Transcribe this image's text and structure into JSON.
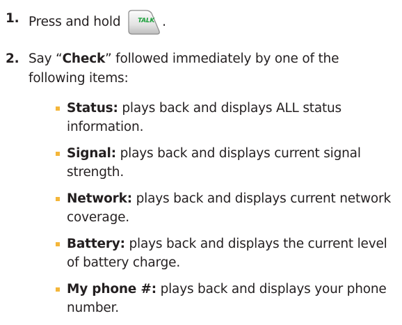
{
  "steps": [
    {
      "number": "1.",
      "text_before": "Press and hold",
      "key_label": "TALK",
      "text_after": "."
    },
    {
      "number": "2.",
      "text_prefix": "Say “",
      "emphasis": "Check",
      "text_suffix": "” followed immediately by one of the following items:"
    }
  ],
  "items": [
    {
      "term": "Status:",
      "desc": " plays back and displays ALL status information."
    },
    {
      "term": "Signal:",
      "desc": " plays back and displays current signal strength."
    },
    {
      "term": "Network:",
      "desc": " plays back and displays current network coverage."
    },
    {
      "term": "Battery:",
      "desc": " plays back and displays the current level of battery charge."
    },
    {
      "term": "My phone #:",
      "desc": " plays back and displays your phone number."
    }
  ],
  "colors": {
    "text": "#231f20",
    "bullet": "#f4b63a",
    "talk_label": "#1aa03a"
  },
  "icons": {
    "talk_key": "talk-key-icon"
  }
}
